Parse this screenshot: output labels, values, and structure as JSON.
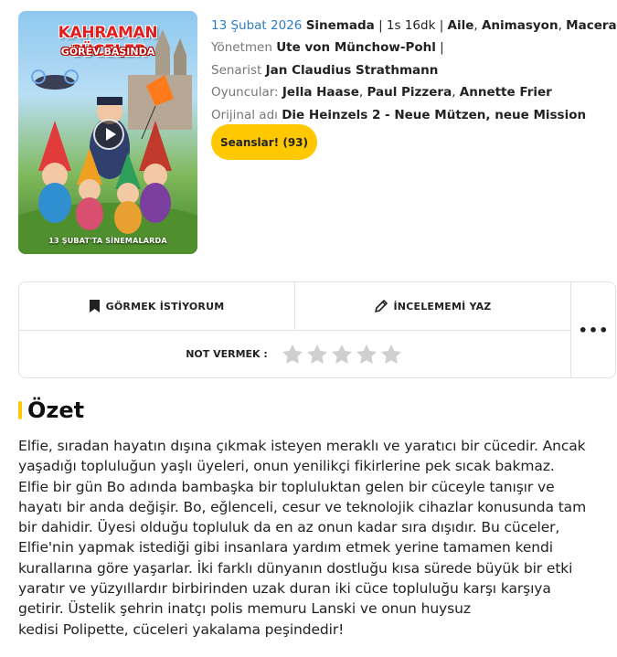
{
  "poster": {
    "title": "KAHRAMAN CÜCELER",
    "subtitle": "GÖREV BAŞINDA",
    "date_text": "13 ŞUBAT'TA SİNEMALARDA",
    "play_icon": "play-icon"
  },
  "meta": {
    "release_date": "13 Şubat 2026",
    "release_status": "Sinemada",
    "duration": "1s 16dk",
    "genres": [
      "Aile",
      "Animasyon",
      "Macera"
    ],
    "director_label": "Yönetmen",
    "director": "Ute von Münchow-Pohl",
    "writer_label": "Senarist",
    "writer": "Jan Claudius Strathmann",
    "cast_label": "Oyuncular:",
    "cast": [
      "Jella Haase",
      "Paul Pizzera",
      "Annette Frier"
    ],
    "original_title_label": "Orijinal adı",
    "original_title": "Die Heinzels 2 - Neue Mützen, neue Mission"
  },
  "sessions_button": {
    "label": "Seanslar! (93)"
  },
  "actions": {
    "watchlist_label": "GÖRMEK İSTİYORUM",
    "watchlist_icon": "bookmark-icon",
    "review_label": "İNCELEMEMİ YAZ",
    "review_icon": "pencil-icon",
    "more_label": "•••",
    "rating_label": "NOT VERMEK :",
    "rating_stars": 5,
    "rating_value": 0
  },
  "summary": {
    "heading": "Özet",
    "lines": [
      "Elfie, sıradan hayatın dışına çıkmak isteyen meraklı ve yaratıcı bir cücedir. Ancak",
      "yaşadığı topluluğun yaşlı üyeleri, onun yenilikçi fikirlerine pek sıcak bakmaz.",
      "Elfie bir gün Bo adında bambaşka bir topluluktan gelen bir cüceyle tanışır ve",
      "hayatı bir anda değişir. Bo, eğlenceli, cesur ve teknolojik cihazlar konusunda tam",
      "bir dahidir. Üyesi olduğu topluluk da en az onun kadar sıra dışıdır. Bu cüceler,",
      "Elfie'nin yapmak istediği gibi insanlara yardım etmek yerine tamamen kendi",
      "kurallarına göre yaşarlar. İki farklı dünyanın dostluğu kısa sürede büyük bir etki",
      "yaratır ve yüzyıllardır birbirinden uzak duran iki cüce topluluğu karşı karşıya",
      "getirir. Üstelik şehrin inatçı polis memuru Lanski ve onun huysuz",
      "kedisi Polipette, cüceleri yakalama peşindedir!"
    ]
  },
  "colors": {
    "accent_yellow": "#ffc800",
    "date_blue": "#2f7dc1",
    "star_gray": "#cfcfcf"
  }
}
